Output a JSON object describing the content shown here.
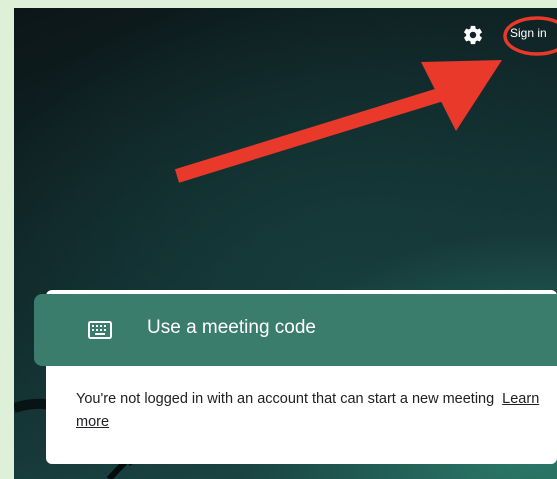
{
  "header": {
    "settings_icon": "gear-icon",
    "sign_in_label": "Sign in"
  },
  "meeting_code": {
    "icon": "keyboard-icon",
    "label": "Use a meeting code"
  },
  "notice": {
    "message": "You're not logged in with an account that can start a new meeting",
    "link_label": "Learn more"
  },
  "colors": {
    "accent_green": "#3b7d6c",
    "annotation_red": "#e8392b",
    "frame_background": "#dff0d8"
  },
  "annotations": {
    "arrow": "red-arrow-pointing-to-sign-in",
    "circle": "red-circle-around-sign-in"
  }
}
